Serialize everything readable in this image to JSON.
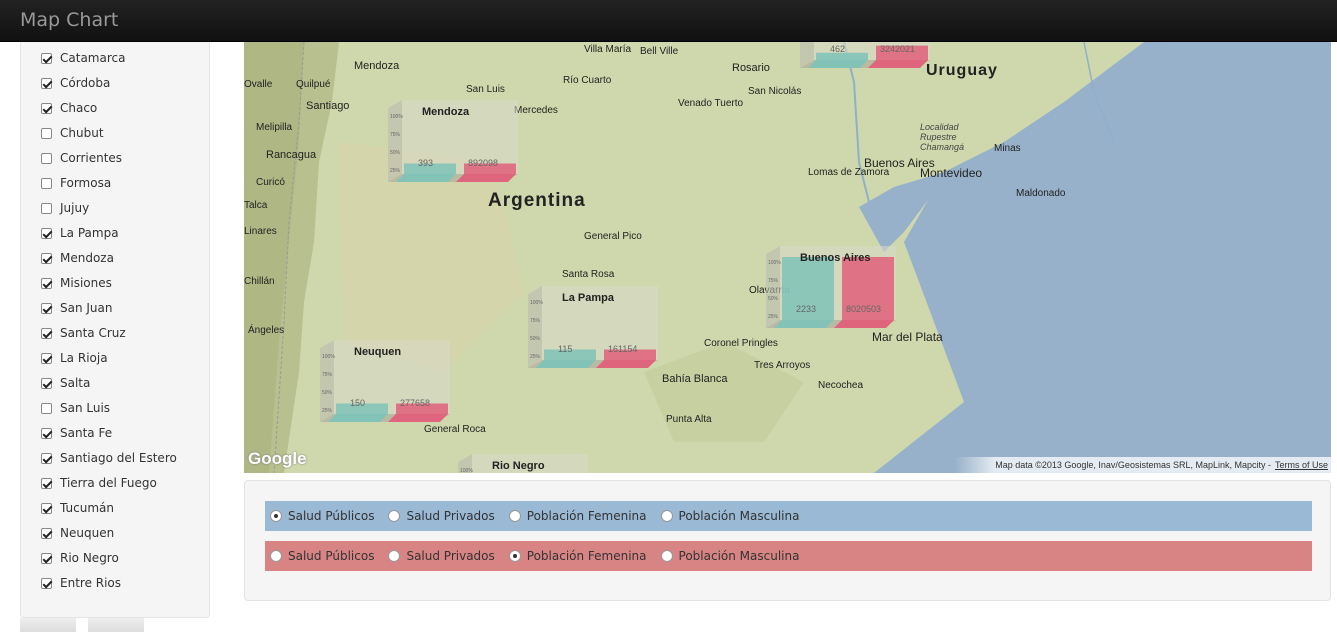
{
  "app": {
    "title": "Map Chart"
  },
  "sidebar": {
    "provinces": [
      {
        "name": "Catamarca",
        "checked": true
      },
      {
        "name": "Córdoba",
        "checked": true
      },
      {
        "name": "Chaco",
        "checked": true
      },
      {
        "name": "Chubut",
        "checked": false
      },
      {
        "name": "Corrientes",
        "checked": false
      },
      {
        "name": "Formosa",
        "checked": false
      },
      {
        "name": "Jujuy",
        "checked": false
      },
      {
        "name": "La Pampa",
        "checked": true
      },
      {
        "name": "Mendoza",
        "checked": true
      },
      {
        "name": "Misiones",
        "checked": true
      },
      {
        "name": "San Juan",
        "checked": true
      },
      {
        "name": "Santa Cruz",
        "checked": true
      },
      {
        "name": "La Rioja",
        "checked": true
      },
      {
        "name": "Salta",
        "checked": true
      },
      {
        "name": "San Luis",
        "checked": false
      },
      {
        "name": "Santa Fe",
        "checked": true
      },
      {
        "name": "Santiago del Estero",
        "checked": true
      },
      {
        "name": "Tierra del Fuego",
        "checked": true
      },
      {
        "name": "Tucumán",
        "checked": true
      },
      {
        "name": "Neuquen",
        "checked": true
      },
      {
        "name": "Rio Negro",
        "checked": true
      },
      {
        "name": "Entre Rios",
        "checked": true
      }
    ]
  },
  "map": {
    "country_labels": {
      "argentina": "Argentina",
      "uruguay": "Uruguay"
    },
    "cities": [
      "Mendoza",
      "Santiago",
      "San Luis",
      "Rosario",
      "San Nicolás",
      "Venado Tuerto",
      "Mercedes",
      "Río Cuarto",
      "Villa María",
      "Rancagua",
      "Curicó",
      "Talca",
      "Linares",
      "Chillán",
      "Ángeles",
      "Buenos Aires",
      "Lomas de Zamora",
      "Montevideo",
      "Minas",
      "Maldonado",
      "General Pico",
      "Santa Rosa",
      "Olavarría",
      "Coronel Pringles",
      "Tres Arroyos",
      "Bahía Blanca",
      "Punta Alta",
      "Mar del Plata",
      "Necochea",
      "General Roca",
      "Quilpué",
      "Melipilla",
      "Ovalle",
      "Bell Ville"
    ],
    "region_labels": [
      "Localidad Rupestre Chamangá"
    ],
    "attribution": "Map data ©2013 Google, Inav/Geosistemas SRL, MapLink, Mapcity -",
    "terms": "Terms of Use",
    "google_logo": "Google",
    "colors": {
      "series_public": "#7fc3b8",
      "series_female": "#e0607a"
    },
    "axis_ticks": [
      "100%",
      "75%",
      "50%",
      "25%"
    ],
    "charts": [
      {
        "province": "Mendoza",
        "values": {
          "public": "393",
          "female": "892098"
        }
      },
      {
        "province": "Buenos Aires",
        "values": {
          "public": "2233",
          "female": "8020503"
        }
      },
      {
        "province": "La Pampa",
        "values": {
          "public": "115",
          "female": "161154"
        }
      },
      {
        "province": "Neuquen",
        "values": {
          "public": "150",
          "female": "277658"
        }
      },
      {
        "province": "Rio Negro",
        "values": {}
      },
      {
        "province": "",
        "values": {
          "public": "462",
          "female": "3242021"
        }
      }
    ]
  },
  "controls": {
    "row1": {
      "options": [
        "Salud Públicos",
        "Salud Privados",
        "Población Femenina",
        "Población Masculina"
      ],
      "selected": "Salud Públicos",
      "color": "#99b9d5"
    },
    "row2": {
      "options": [
        "Salud Públicos",
        "Salud Privados",
        "Población Femenina",
        "Población Masculina"
      ],
      "selected": "Población Femenina",
      "color": "#d88484"
    }
  }
}
